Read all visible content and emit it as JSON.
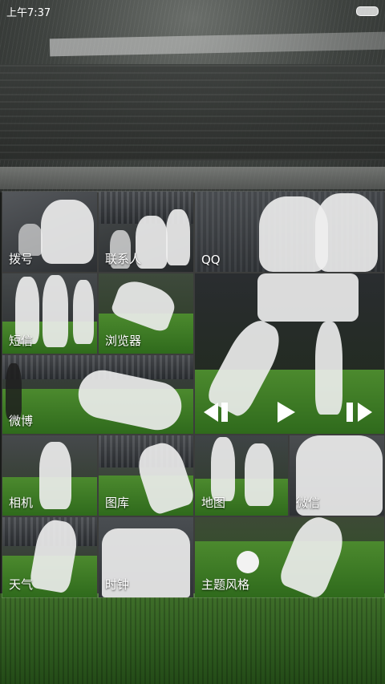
{
  "status_bar": {
    "time": "上午7:37"
  },
  "tiles": [
    {
      "id": "dialer",
      "label": "拨号"
    },
    {
      "id": "contacts",
      "label": "联系人"
    },
    {
      "id": "qq",
      "label": "QQ"
    },
    {
      "id": "sms",
      "label": "短信"
    },
    {
      "id": "browser",
      "label": "浏览器"
    },
    {
      "id": "weibo",
      "label": "微博"
    },
    {
      "id": "camera",
      "label": "相机"
    },
    {
      "id": "gallery",
      "label": "图库"
    },
    {
      "id": "map",
      "label": "地图"
    },
    {
      "id": "wechat",
      "label": "微信"
    },
    {
      "id": "weather",
      "label": "天气"
    },
    {
      "id": "clock",
      "label": "时钟"
    },
    {
      "id": "themes",
      "label": "主题风格"
    }
  ],
  "music_widget": {
    "controls": [
      "previous",
      "play",
      "next"
    ]
  },
  "colors": {
    "label_text": "#ffffff",
    "grass": "#2e5a1f",
    "stadium": "#3e423f"
  },
  "icons": [
    "battery-icon",
    "previous-icon",
    "play-icon",
    "next-icon"
  ]
}
